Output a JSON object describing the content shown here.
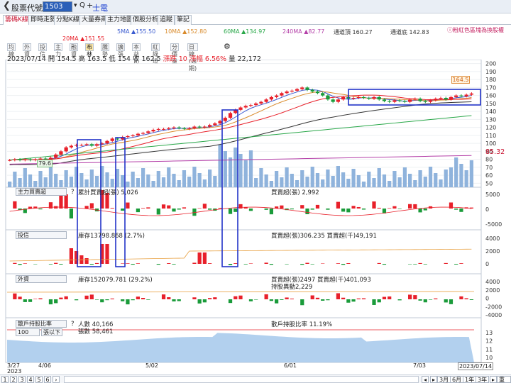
{
  "topbar": {
    "back": "❮",
    "title": "股票代號",
    "code": "1503",
    "dropdown": "▾",
    "search": "Q",
    "plus": "+",
    "stock_name": "士電"
  },
  "tabs": [
    "籌碼K線",
    "即時走勢",
    "分點K線",
    "大量券商",
    "主力地圖",
    "個股分析",
    "追蹤",
    "筆記"
  ],
  "hint": "ⓘ粉紅色區塊為換股權",
  "ma": {
    "ma5": "5MA ▲155.50",
    "ma10": "10MA ▲152.80",
    "ma60": "60MA ▲134.97",
    "ma240": "240MA ▲82.77",
    "ch_top": "通道頂 160.27",
    "ch_bot": "通道底 142.83",
    "ma20": "20MA ▲151.55"
  },
  "toolbar": [
    "均線",
    "外資",
    "投信",
    "主力",
    "融資",
    "布林",
    "騰勢",
    "擴張",
    "本益比",
    "紅綠燈",
    "分價量",
    "日線(週期)"
  ],
  "toolbar_gear": "⚙",
  "info": {
    "date": "2023/07/14",
    "open": "開 154.5",
    "high": "高 163.5",
    "low": "低 154",
    "close": "收 162.5",
    "chg": "漲跌 10",
    "pct": "漲幅 6.56%",
    "vol": "量 22,172"
  },
  "price_axis": [
    "200",
    "190",
    "180",
    "170",
    "160",
    "150",
    "140",
    "130",
    "120",
    "110",
    "100",
    "90",
    "80",
    "70",
    "60",
    "50"
  ],
  "price_tags": {
    "last": "164.5",
    "right": "85.32",
    "left": "79.6"
  },
  "panels": {
    "main": {
      "label": "主力買賣超",
      "q": "?",
      "t1": "累計買賣超(張) 5,026",
      "t2": "買賣超(張) 2,992",
      "axis": [
        "5000",
        "0",
        "-5000"
      ]
    },
    "trust": {
      "label": "投信",
      "t1": "庫存13798.868 (2.7%)",
      "t2": "買賣超(張)306.235 買賣超(千)49,191",
      "axis": [
        "4000",
        "2000",
        "0"
      ]
    },
    "foreign": {
      "label": "外資",
      "t1": "庫存152079.781 (29.2%)",
      "t2": "買賣超(張)2497 買賣超(千)401,093",
      "t3": "持股異動2,229",
      "axis": [
        "4000",
        "2000",
        "0",
        "-2000",
        "-4000"
      ]
    },
    "holders": {
      "label": "散戶持股比率",
      "q": "?",
      "sel": "100",
      "sel2": "張以下",
      "t1": "人數 40,166",
      "t2": "張數 58,461",
      "t3": "散戶持股比率 11.19%",
      "axis": [
        "13",
        "12",
        "11",
        "10"
      ]
    }
  },
  "xdates": [
    "3/27",
    "4/06",
    "5/02",
    "6/01",
    "7/03",
    "2023/07/14"
  ],
  "xyear": "2023",
  "bottom": {
    "pages": [
      "1",
      "2",
      "3",
      "4",
      "5",
      "6"
    ],
    "next": "›",
    "ranges": [
      "3月",
      "6月",
      "1年",
      "3年"
    ],
    "nav": [
      "◂",
      "▸"
    ],
    "reset": "重僅"
  },
  "colors": {
    "up": "#e8202a",
    "down": "#1a9b3a",
    "vol": "#8fb3dc",
    "box": "#2233c8"
  },
  "chart_data": {
    "type": "candlestick",
    "closes": [
      79,
      80,
      79,
      80,
      79,
      80,
      81,
      80,
      82,
      86,
      90,
      95,
      97,
      98,
      98,
      99,
      97,
      99,
      100,
      103,
      106,
      105,
      108,
      109,
      110,
      112,
      113,
      115,
      117,
      118,
      118,
      119,
      120,
      119,
      118,
      119,
      121,
      120,
      121,
      123,
      125,
      128,
      132,
      138,
      142,
      145,
      147,
      148,
      150,
      152,
      155,
      158,
      160,
      163,
      165,
      166,
      168,
      170,
      167,
      165,
      163,
      160,
      155,
      152,
      155,
      158,
      156,
      157,
      158,
      157,
      156,
      158,
      155,
      153,
      152,
      154,
      153,
      152,
      155,
      156,
      153,
      152,
      154,
      156,
      157,
      155,
      158,
      160,
      159,
      161,
      162.5
    ]
  }
}
